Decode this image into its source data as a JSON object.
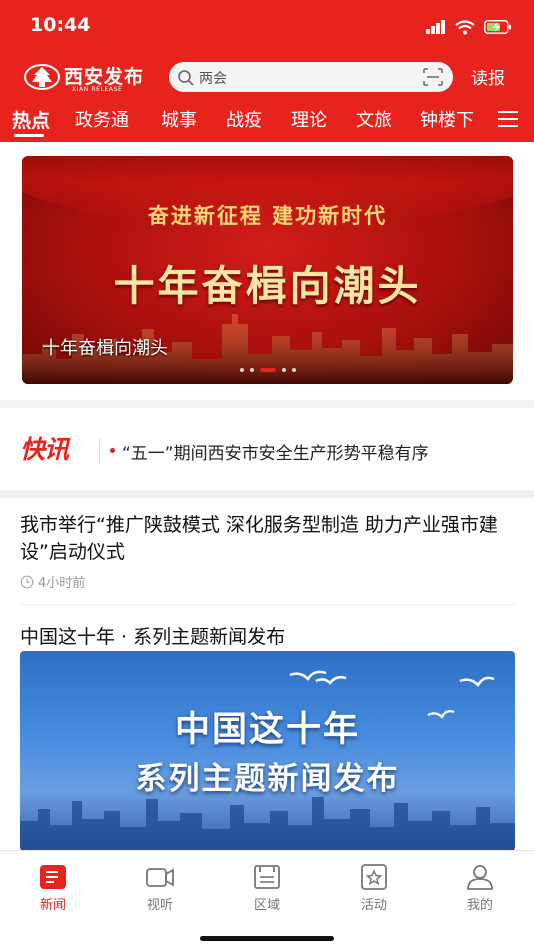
{
  "status_bar": {
    "time": "10:44"
  },
  "header": {
    "logo_text": "西安发布",
    "logo_sub": "XIAN RELEASE",
    "search_placeholder": "两会",
    "read_paper": "读报",
    "nav_items": [
      "热点",
      "政务通",
      "城事",
      "战疫",
      "理论",
      "文旅",
      "钟楼下"
    ],
    "active_nav": "热点"
  },
  "banner": {
    "subtitle": "奋进新征程  建功新时代",
    "headline": "十年奋楫向潮头",
    "caption": "十年奋楫向潮头",
    "dot_count": 5,
    "active_dot": 2
  },
  "flash_news": {
    "logo": "快讯",
    "text": "“五一”期间西安市安全生产形势平稳有序"
  },
  "articles": [
    {
      "title": "我市举行“推广陕鼓模式 深化服务型制造 助力产业强市建设”启动仪式",
      "time": "4小时前"
    },
    {
      "title": "中国这十年 · 系列主题新闻发布",
      "image_line1": "中国这十年",
      "image_line2": "系列主题新闻发布"
    }
  ],
  "tabbar": {
    "tabs": [
      {
        "label": "新闻",
        "icon": "news-icon"
      },
      {
        "label": "视听",
        "icon": "video-icon"
      },
      {
        "label": "区域",
        "icon": "region-icon"
      },
      {
        "label": "活动",
        "icon": "activity-icon"
      },
      {
        "label": "我的",
        "icon": "profile-icon"
      }
    ],
    "active": "新闻"
  },
  "colors": {
    "brand_red": "#e8221c",
    "inactive": "#777777"
  }
}
